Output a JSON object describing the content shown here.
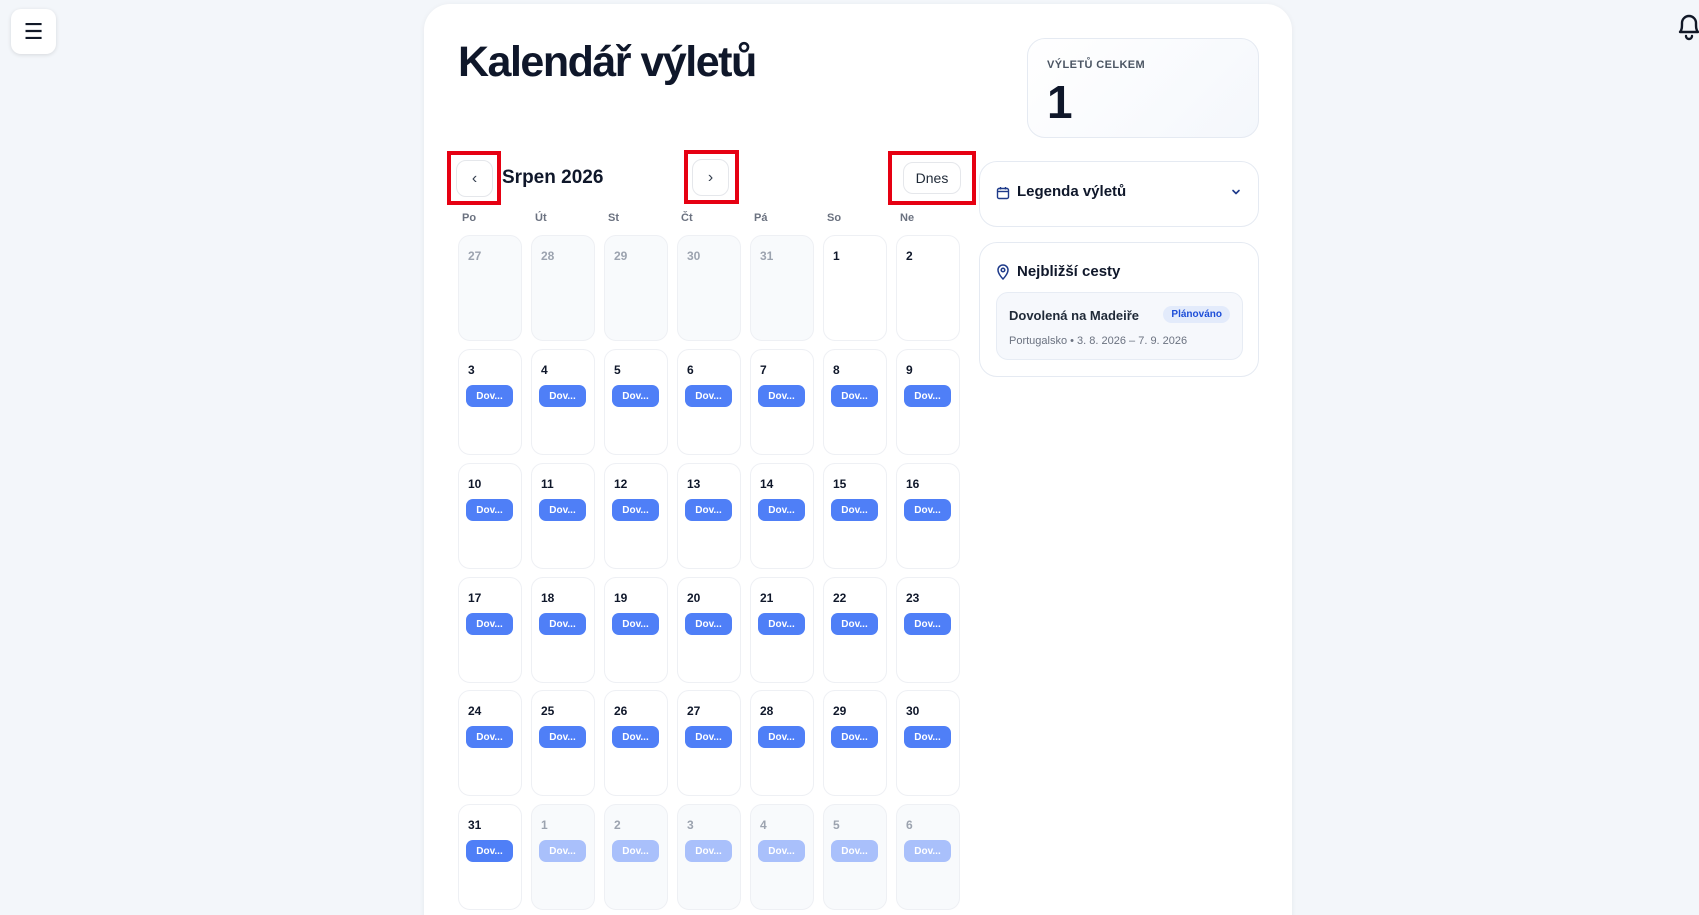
{
  "app": {
    "menu_icon": "hamburger-icon",
    "notification_icon": "bell-icon"
  },
  "page": {
    "title": "Kalendář výletů"
  },
  "calendar": {
    "month_label": "Srpen 2026",
    "prev_label": "‹",
    "next_label": "›",
    "today_label": "Dnes",
    "weekdays": [
      "Po",
      "Út",
      "St",
      "Čt",
      "Pá",
      "So",
      "Ne"
    ],
    "weeks": [
      [
        {
          "d": "27",
          "o": true,
          "e": ""
        },
        {
          "d": "28",
          "o": true,
          "e": ""
        },
        {
          "d": "29",
          "o": true,
          "e": ""
        },
        {
          "d": "30",
          "o": true,
          "e": ""
        },
        {
          "d": "31",
          "o": true,
          "e": ""
        },
        {
          "d": "1",
          "o": false,
          "e": ""
        },
        {
          "d": "2",
          "o": false,
          "e": ""
        }
      ],
      [
        {
          "d": "3",
          "o": false,
          "e": "Dov..."
        },
        {
          "d": "4",
          "o": false,
          "e": "Dov..."
        },
        {
          "d": "5",
          "o": false,
          "e": "Dov..."
        },
        {
          "d": "6",
          "o": false,
          "e": "Dov..."
        },
        {
          "d": "7",
          "o": false,
          "e": "Dov..."
        },
        {
          "d": "8",
          "o": false,
          "e": "Dov..."
        },
        {
          "d": "9",
          "o": false,
          "e": "Dov..."
        }
      ],
      [
        {
          "d": "10",
          "o": false,
          "e": "Dov..."
        },
        {
          "d": "11",
          "o": false,
          "e": "Dov..."
        },
        {
          "d": "12",
          "o": false,
          "e": "Dov..."
        },
        {
          "d": "13",
          "o": false,
          "e": "Dov..."
        },
        {
          "d": "14",
          "o": false,
          "e": "Dov..."
        },
        {
          "d": "15",
          "o": false,
          "e": "Dov..."
        },
        {
          "d": "16",
          "o": false,
          "e": "Dov..."
        }
      ],
      [
        {
          "d": "17",
          "o": false,
          "e": "Dov..."
        },
        {
          "d": "18",
          "o": false,
          "e": "Dov..."
        },
        {
          "d": "19",
          "o": false,
          "e": "Dov..."
        },
        {
          "d": "20",
          "o": false,
          "e": "Dov..."
        },
        {
          "d": "21",
          "o": false,
          "e": "Dov..."
        },
        {
          "d": "22",
          "o": false,
          "e": "Dov..."
        },
        {
          "d": "23",
          "o": false,
          "e": "Dov..."
        }
      ],
      [
        {
          "d": "24",
          "o": false,
          "e": "Dov..."
        },
        {
          "d": "25",
          "o": false,
          "e": "Dov..."
        },
        {
          "d": "26",
          "o": false,
          "e": "Dov..."
        },
        {
          "d": "27",
          "o": false,
          "e": "Dov..."
        },
        {
          "d": "28",
          "o": false,
          "e": "Dov..."
        },
        {
          "d": "29",
          "o": false,
          "e": "Dov..."
        },
        {
          "d": "30",
          "o": false,
          "e": "Dov..."
        }
      ],
      [
        {
          "d": "31",
          "o": false,
          "e": "Dov..."
        },
        {
          "d": "1",
          "o": true,
          "e": "Dov..."
        },
        {
          "d": "2",
          "o": true,
          "e": "Dov..."
        },
        {
          "d": "3",
          "o": true,
          "e": "Dov..."
        },
        {
          "d": "4",
          "o": true,
          "e": "Dov..."
        },
        {
          "d": "5",
          "o": true,
          "e": "Dov..."
        },
        {
          "d": "6",
          "o": true,
          "e": "Dov..."
        }
      ]
    ]
  },
  "stats": {
    "label": "VÝLETŮ CELKEM",
    "value": "1"
  },
  "legend": {
    "title": "Legenda výletů",
    "icon": "calendar-icon",
    "toggle_icon": "chevron-down-icon"
  },
  "upcoming": {
    "title": "Nejbližší cesty",
    "icon": "map-pin-icon",
    "trips": [
      {
        "name": "Dovolená na Madeiře",
        "status": "Plánováno",
        "meta": "Portugalsko • 3. 8. 2026 – 7. 9. 2026"
      }
    ]
  },
  "colors": {
    "accent": "#4f7ff7",
    "highlight": "#e60012",
    "badge_text": "#1d4ed8"
  }
}
